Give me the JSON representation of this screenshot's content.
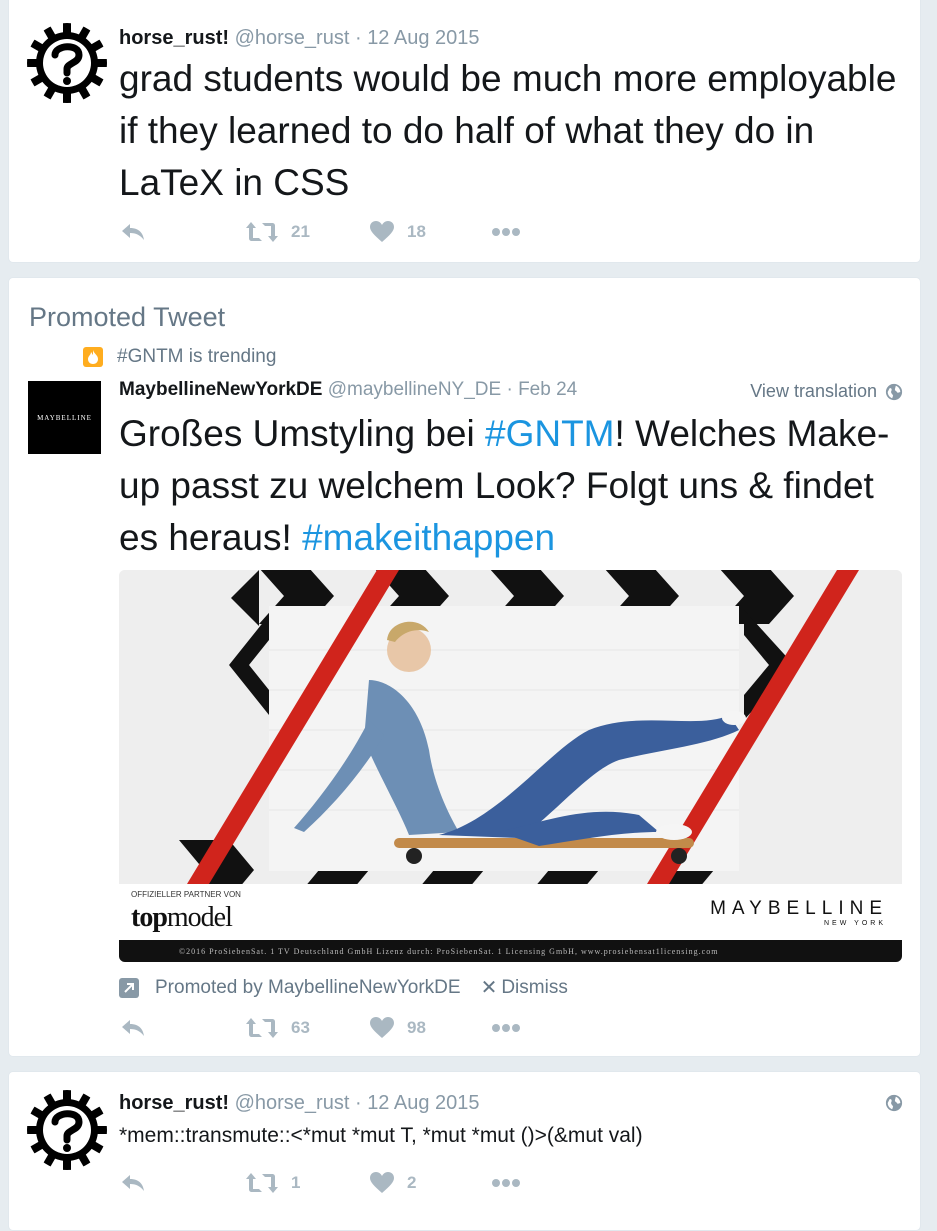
{
  "tweet1": {
    "name": "horse_rust!",
    "handle": "@horse_rust",
    "sep": "·",
    "date": "12 Aug 2015",
    "text": "grad students would be much more employable if they learned to do half of what they do in LaTeX in CSS",
    "retweets": "21",
    "likes": "18"
  },
  "promo": {
    "label": "Promoted Tweet",
    "trend": "#GNTM is trending",
    "name": "MaybellineNewYorkDE",
    "handle": "@maybellineNY_DE",
    "sep": "·",
    "date": "Feb 24",
    "view_translation": "View translation",
    "text_1": "Großes Umstyling bei ",
    "hashtag_1": "#GNTM",
    "text_2": "! Welches Make-up passt zu welchem Look? Folgt uns & findet es heraus! ",
    "hashtag_2": "#makeithappen",
    "avatar_text": "MAYBELLINE",
    "media": {
      "partner_label": "OFFIZIELLER PARTNER VON",
      "topmodel_a": "top",
      "topmodel_b": "model",
      "brand": "MAYBELLINE",
      "brand_sub": "NEW YORK",
      "copyright": "©2016 ProSiebenSat. 1 TV Deutschland GmbH Lizenz durch: ProSiebenSat. 1 Licensing GmbH, www.prosiebensat1licensing.com"
    },
    "promoted_by": "Promoted by MaybellineNewYorkDE",
    "dismiss": "Dismiss",
    "retweets": "63",
    "likes": "98"
  },
  "tweet3": {
    "name": "horse_rust!",
    "handle": "@horse_rust",
    "sep": "·",
    "date": "12 Aug 2015",
    "text": "*mem::transmute::<*mut *mut T, *mut *mut ()>(&mut val)",
    "retweets": "1",
    "likes": "2"
  },
  "colors": {
    "link": "#1b95e0",
    "meta": "#8899a6",
    "action": "#aab8c2",
    "trend_badge": "#ffad1f"
  },
  "icons": [
    "rust-gear-avatar",
    "reply-icon",
    "retweet-icon",
    "heart-icon",
    "more-icon",
    "globe-icon",
    "flame-icon",
    "promoted-arrow-icon",
    "close-icon"
  ]
}
